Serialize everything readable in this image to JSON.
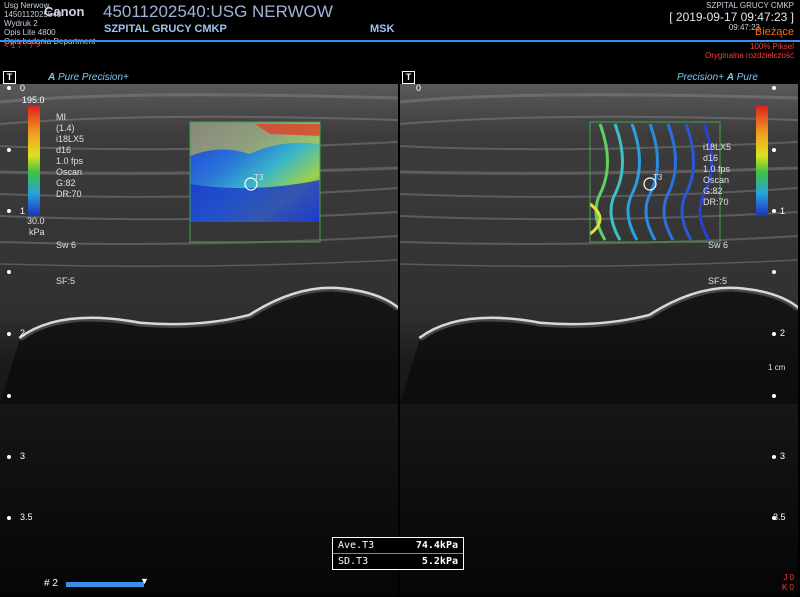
{
  "header": {
    "left_lines": [
      "Usg Nerwow",
      "1450112025540",
      "Wydruk 2",
      "Opis Lite 4800",
      "Opis badania Department"
    ],
    "brand": "Canon",
    "patient": "45011202540:USG NERWOW",
    "hospital": "SZPITAL GRUCY CMKP",
    "region": "MSK",
    "right_small": "SZPITAL GRUCY CMKP",
    "datetime": "[ 2019-09-17 09:47:23 ]",
    "time_ghost": "09:47:23",
    "status": "Bieżące",
    "pixel_info": "100% Piksel",
    "res_info": "Oryginalna rozdzielczość",
    "left_red": "< 1 7 - 7 >"
  },
  "left_panel": {
    "t_label": "T",
    "brand_a": "A",
    "brand_pure": "Pure",
    "brand_precision": "Precision+",
    "scale_top": "195.0",
    "scale_bottom": "30.0",
    "scale_unit": "kPa",
    "params": [
      "MI",
      "(1.4)",
      "i18LX5",
      "d16",
      "1.0 fps",
      "Oscan",
      "G:82",
      "DR:70"
    ],
    "sw": "Sw 6",
    "sf": "SF:5",
    "roi_label": "T3"
  },
  "right_panel": {
    "t_label": "T",
    "brand_precision": "Precision+",
    "brand_a": "A",
    "brand_pure": "Pure",
    "params": [
      "i18LX5",
      "d16",
      "1.0 fps",
      "Oscan",
      "G:82",
      "DR:70"
    ],
    "sw": "Sw 6",
    "sf": "SF:5",
    "roi_label": "T3",
    "cm_label": "1 cm"
  },
  "depth_marks": [
    "0",
    "0.5",
    "1",
    "1.5",
    "2",
    "2.5",
    "3",
    "3.5"
  ],
  "depth_labels": [
    "0",
    "1",
    "2",
    "3",
    "3.5"
  ],
  "measurements": [
    {
      "label": "Ave.T3",
      "value": "74.4kPa"
    },
    {
      "label": "SD.T3",
      "value": "5.2kPa"
    }
  ],
  "footer": {
    "cine_label": "# 2",
    "right_j": "J 0",
    "right_k": "K 0"
  },
  "colors": {
    "accent": "#3a8ee6",
    "status": "#ff6a00",
    "roi": "#3fa34d"
  }
}
